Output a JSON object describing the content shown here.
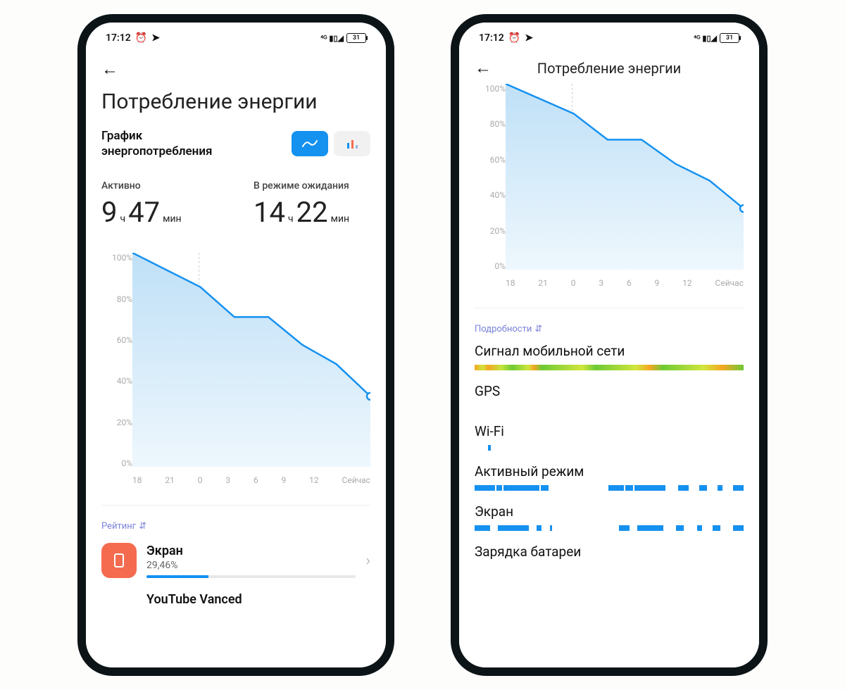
{
  "status": {
    "time": "17:12",
    "battery": "31"
  },
  "left": {
    "title": "Потребление энергии",
    "graph_label": "График энергопотребления",
    "active_label": "Активно",
    "standby_label": "В режиме ожидания",
    "active_h": "9",
    "active_h_unit": "ч",
    "active_m": "47",
    "active_m_unit": "мин",
    "standby_h": "14",
    "standby_h_unit": "ч",
    "standby_m": "22",
    "standby_m_unit": "мин",
    "ranking_label": "Рейтинг",
    "rank1_name": "Экран",
    "rank1_pct": "29,46%",
    "rank2_name": "YouTube Vanced"
  },
  "right": {
    "title": "Потребление энергии",
    "details_label": "Подробности",
    "d1": "Сигнал мобильной сети",
    "d2": "GPS",
    "d3": "Wi-Fi",
    "d4": "Активный режим",
    "d5": "Экран",
    "d6": "Зарядка батареи"
  },
  "chart_data": {
    "type": "area",
    "title": "Потребление энергии",
    "xlabel": "",
    "ylabel": "%",
    "ylim": [
      0,
      100
    ],
    "y_ticks": [
      "100%",
      "80%",
      "60%",
      "40%",
      "20%",
      "0%"
    ],
    "x_ticks": [
      "18",
      "21",
      "0",
      "3",
      "6",
      "9",
      "12",
      "Сейчас"
    ],
    "x": [
      "18",
      "21",
      "0",
      "3",
      "6",
      "9",
      "12",
      "Сейчас"
    ],
    "values": [
      100,
      92,
      84,
      70,
      70,
      57,
      48,
      33
    ]
  }
}
